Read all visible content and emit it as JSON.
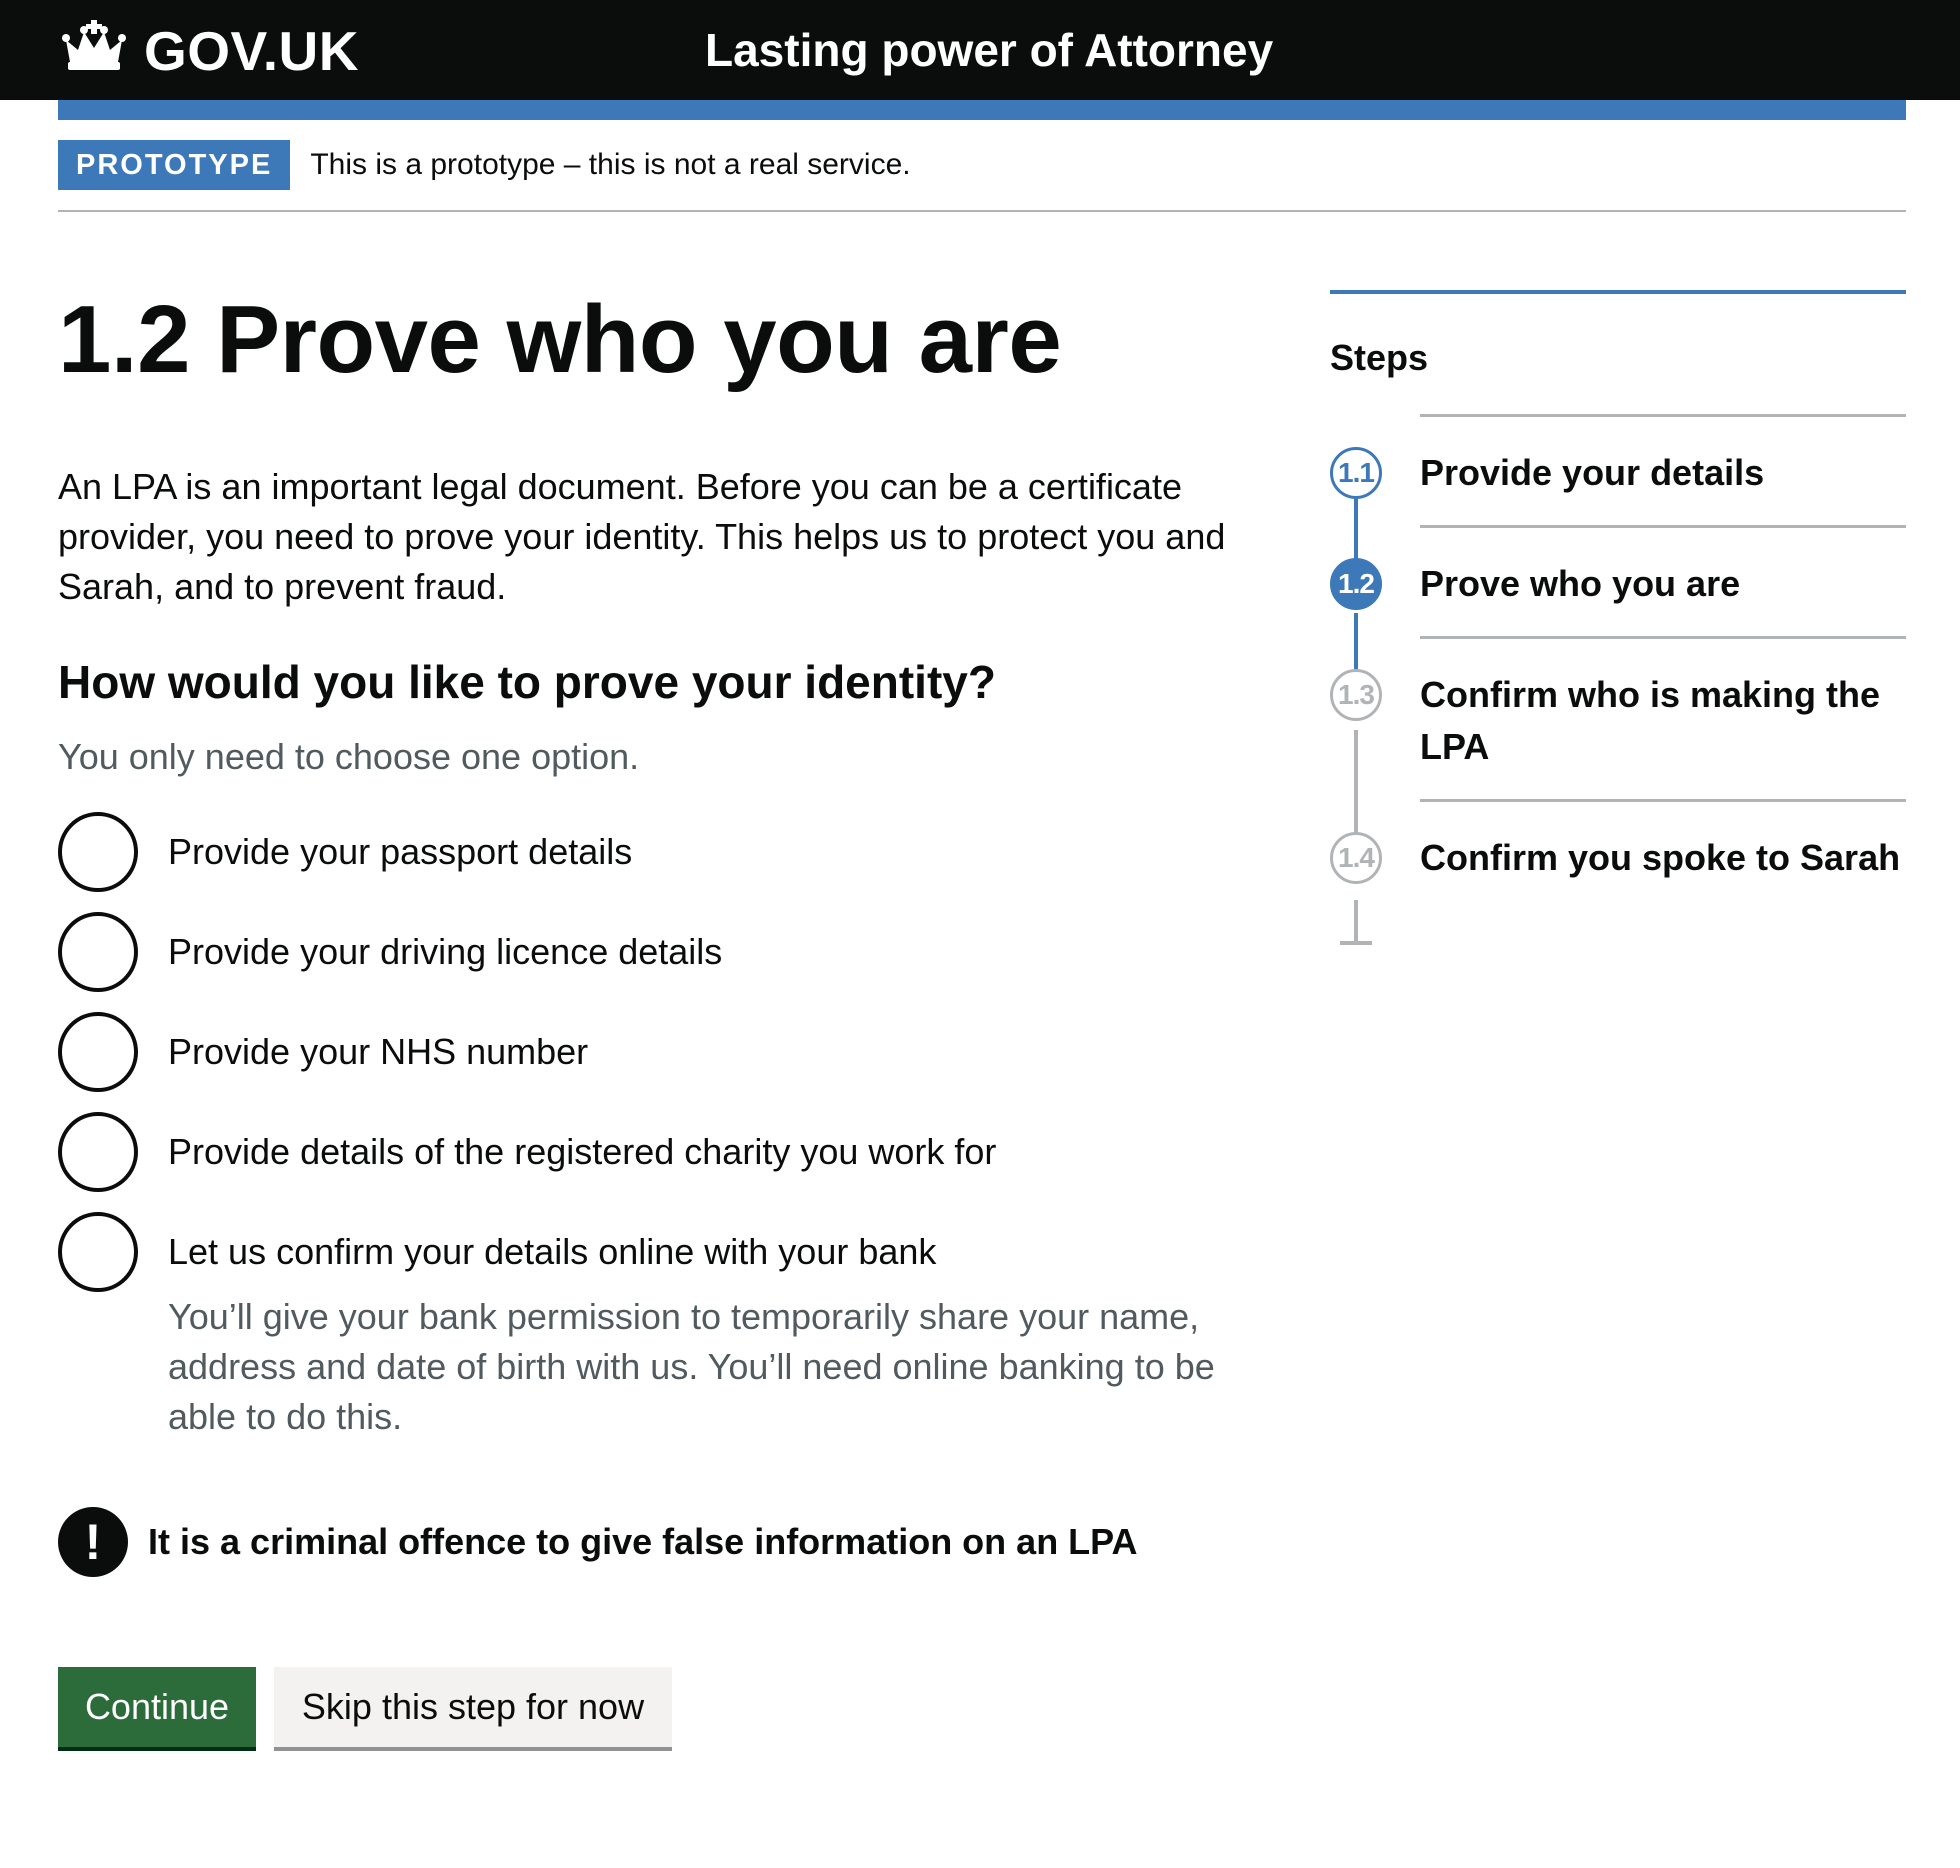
{
  "header": {
    "logo_text": "GOV.UK",
    "service_name": "Lasting power of Attorney"
  },
  "phase_banner": {
    "tag": "PROTOTYPE",
    "text": "This is a prototype – this is not a real service."
  },
  "main": {
    "title": "1.2 Prove who you are",
    "intro": "An LPA is an important legal document. Before you can be a certificate provider, you need to prove your identity. This helps us to protect you and Sarah, and to prevent fraud.",
    "question": "How would you like to prove your identity?",
    "hint": "You only need to choose one option.",
    "options": [
      {
        "label": "Provide your passport details",
        "selected": false
      },
      {
        "label": "Provide your driving licence details",
        "selected": false
      },
      {
        "label": "Provide your NHS number",
        "selected": false
      },
      {
        "label": "Provide details of the registered charity you work for",
        "selected": false
      },
      {
        "label": "Let us confirm your details online with your bank",
        "selected": false,
        "hint": "You’ll give your bank permission to temporarily share your name, address and date of birth with us. You’ll need online banking to be able to do this."
      }
    ],
    "warning": "It is a criminal offence to give false information on an LPA",
    "warning_icon": "!",
    "continue_label": "Continue",
    "skip_label": "Skip this step for now"
  },
  "sidebar": {
    "title": "Steps",
    "steps": [
      {
        "number": "1.1",
        "label": "Provide your details",
        "status": "done"
      },
      {
        "number": "1.2",
        "label": "Prove who you are",
        "status": "active"
      },
      {
        "number": "1.3",
        "label": "Confirm who is making the LPA",
        "status": "todo"
      },
      {
        "number": "1.4",
        "label": "Confirm you spoke to Sarah",
        "status": "todo"
      }
    ]
  },
  "colors": {
    "header_bg": "#0b0c0c",
    "brand_blue": "#3d78b8",
    "primary_button": "#2c6b3a",
    "secondary_button": "#f3f2f1",
    "hint_text": "#505a5f",
    "border_grey": "#b1b4b6"
  }
}
